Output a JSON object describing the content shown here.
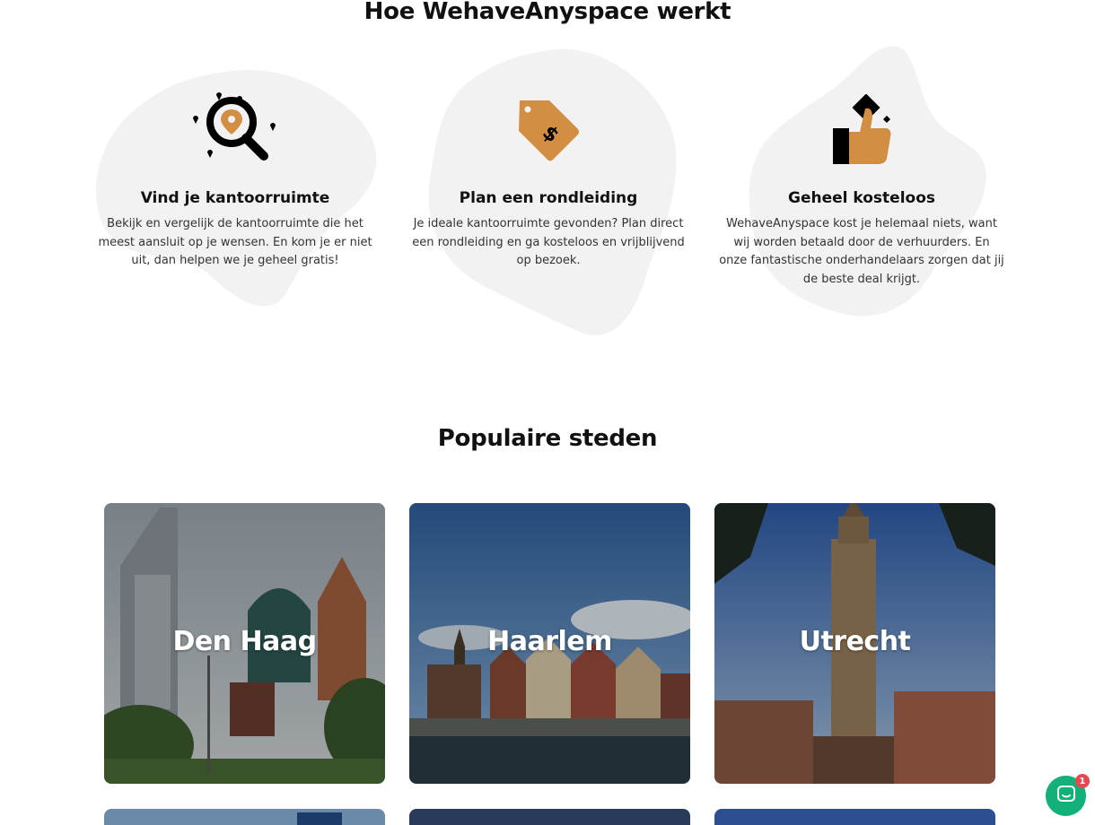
{
  "how_it_works": {
    "title": "Hoe WehaveAnyspace werkt",
    "steps": [
      {
        "icon": "search-location-icon",
        "title": "Vind je kantoorruimte",
        "description": "Bekijk en vergelijk de kantoorruimte die het meest aansluit op je wensen. En kom je er niet uit, dan helpen we je geheel gratis!"
      },
      {
        "icon": "price-tag-icon",
        "title": "Plan een rondleiding",
        "description": "Je ideale kantoorruimte gevonden? Plan direct een rondleiding en ga kosteloos en vrijblijvend op bezoek."
      },
      {
        "icon": "thumbs-up-icon",
        "title": "Geheel kosteloos",
        "description": "WehaveAnyspace kost je helemaal niets, want wij worden betaald door de verhuurders. En onze fantastische onderhandelaars zorgen dat jij de beste deal krijgt."
      }
    ]
  },
  "popular_cities": {
    "title": "Populaire steden",
    "cities": [
      {
        "name": "Den Haag"
      },
      {
        "name": "Haarlem"
      },
      {
        "name": "Utrecht"
      }
    ]
  },
  "chat": {
    "icon": "chat-icon",
    "unread_count": "1"
  },
  "colors": {
    "accent": "#d28e42",
    "blob": "#f2f2f2",
    "chat": "#14b07a",
    "badge": "#e5484d"
  }
}
